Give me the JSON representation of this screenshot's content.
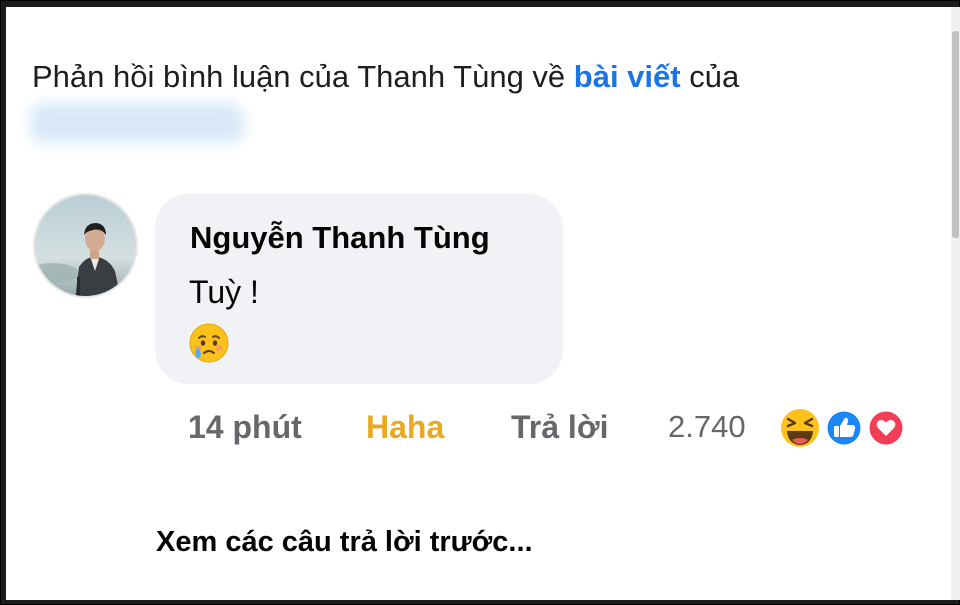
{
  "header": {
    "prefix": "Phản hồi bình luận của Thanh Tùng về ",
    "link_text": "bài viết",
    "suffix": " của"
  },
  "comment": {
    "author": "Nguyễn Thanh Tùng",
    "text": "Tuỳ !",
    "sticker_icon": "crying-face-icon",
    "time": "14 phút",
    "reaction_label": "Haha",
    "reply_label": "Trả lời",
    "reaction_count": "2.740",
    "reaction_icons": [
      "haha-icon",
      "like-icon",
      "love-icon"
    ]
  },
  "footer": {
    "view_previous": "Xem các câu trả lời trước..."
  },
  "colors": {
    "link": "#1b74e4",
    "haha": "#eaa823",
    "muted": "#65676b",
    "bubble": "#f0f2f5"
  }
}
